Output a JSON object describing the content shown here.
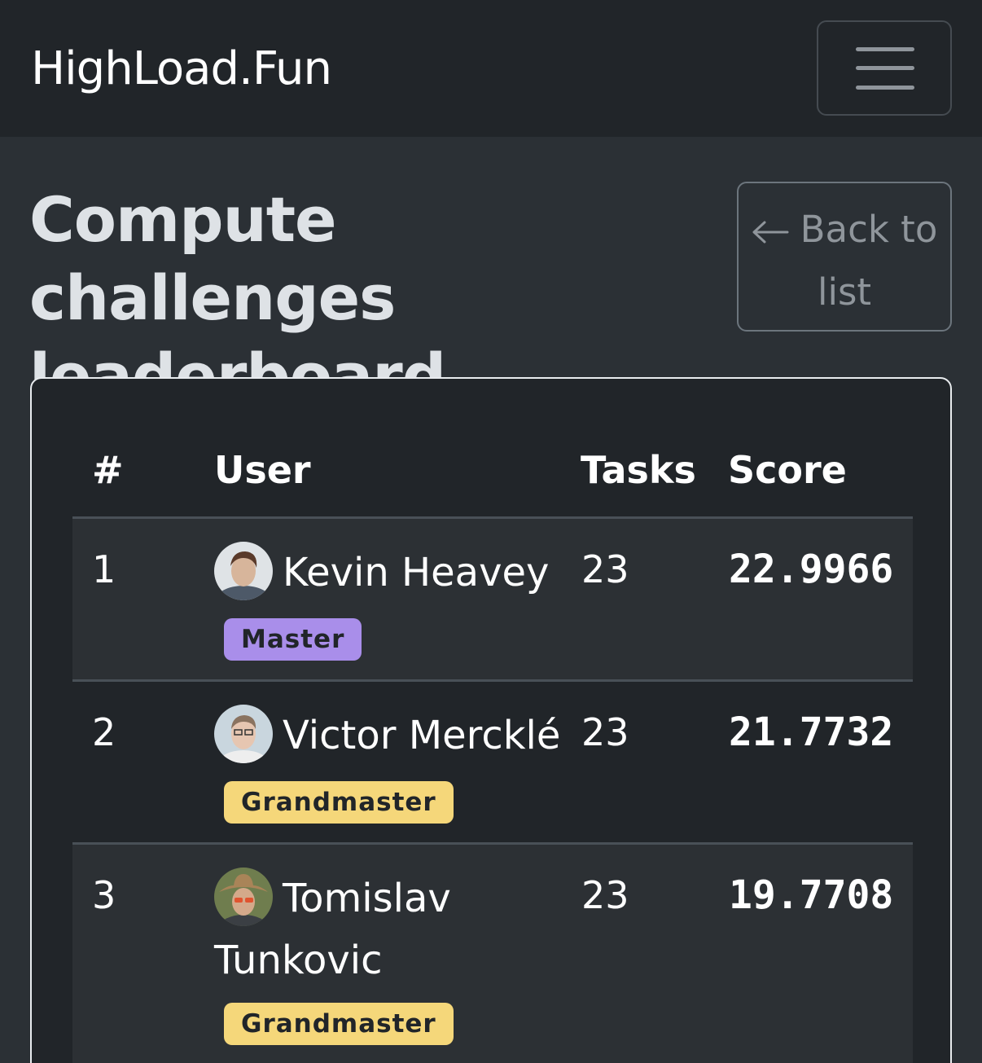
{
  "navbar": {
    "brand": "HighLoad.Fun",
    "menu_icon": "hamburger-menu-icon"
  },
  "header": {
    "title": "Compute challenges leaderboard",
    "back_label": "Back to list",
    "back_icon": "arrow-left-icon"
  },
  "table": {
    "headers": {
      "rank": "#",
      "user": "User",
      "tasks": "Tasks",
      "score": "Score"
    },
    "rows": [
      {
        "rank": "1",
        "user": "Kevin Heavey",
        "tasks": "23",
        "score": "22.9966",
        "badge": "Master"
      },
      {
        "rank": "2",
        "user": "Victor Mercklé",
        "tasks": "23",
        "score": "21.7732",
        "badge": "Grandmaster"
      },
      {
        "rank": "3",
        "user": "Tomislav Tunkovic",
        "tasks": "23",
        "score": "19.7708",
        "badge": "Grandmaster"
      }
    ]
  },
  "colors": {
    "master_badge": "#a98eea",
    "grandmaster_badge": "#f5d77a",
    "page_bg": "#2b3035",
    "navbar_bg": "#212529"
  }
}
